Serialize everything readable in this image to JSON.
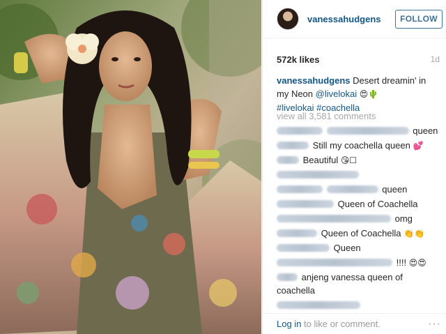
{
  "post": {
    "image_alt": "Woman with long curly dark hair and a hibiscus flower, wearing a floral kimono"
  },
  "header": {
    "username": "vanessahudgens",
    "follow_label": "FOLLOW"
  },
  "stats": {
    "likes": "572k likes",
    "time": "1d"
  },
  "caption": {
    "username": "vanessahudgens",
    "text": "Desert dreamin' in my Neon",
    "mention": "@livelokai",
    "emoji": "😍🌵",
    "hashtag1": "#livelokai",
    "hashtag2": "#coachella"
  },
  "view_all": "view all 3,581 comments",
  "comments": [
    {
      "text": "queen",
      "emoji": ""
    },
    {
      "text": "Still my coachella queen",
      "emoji": "💕"
    },
    {
      "text": "Beautiful",
      "emoji": "😘☐"
    },
    {
      "text": "queen",
      "emoji": ""
    },
    {
      "text": "Queen of Coachella",
      "emoji": ""
    },
    {
      "text": "omg",
      "emoji": ""
    },
    {
      "text": "Queen of Coachella",
      "emoji": "👏👏"
    },
    {
      "text": "Queen",
      "emoji": ""
    },
    {
      "text": "!!!!",
      "emoji": "😍😍"
    },
    {
      "text": "anjeng vanessa queen of coachella",
      "emoji": ""
    }
  ],
  "footer": {
    "login_label": "Log in",
    "rest": "to like or comment.",
    "more": "···"
  },
  "colors": {
    "link": "#125688",
    "follow": "#3f729b",
    "muted": "#a5a7aa"
  }
}
